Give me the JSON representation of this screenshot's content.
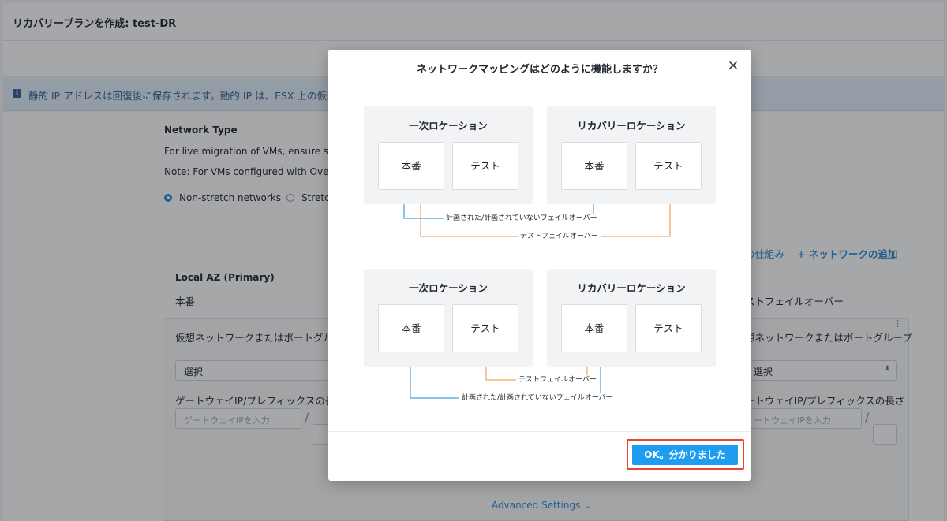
{
  "page": {
    "title": "リカバリープランを作成: test-DR",
    "banner_text": "静的 IP アドレスは回復後に保存されます。動的 IP は、ESX 上の仮想"
  },
  "network_type": {
    "heading": "Network Type",
    "line1": "For live migration of VMs, ensure sour",
    "line2": "Note: For VMs configured with Overla",
    "options": [
      {
        "label": "Non-stretch networks",
        "selected": true
      },
      {
        "label": "Stretc",
        "selected": false
      }
    ]
  },
  "links": {
    "how_it_works": "の仕組み",
    "add_network": "+ ネットワークの追加",
    "advanced_settings": "Advanced Settings ⌄"
  },
  "local_az": {
    "heading": "Local AZ (Primary)",
    "env": "本番",
    "vnet_label": "仮想ネットワークまたはポートグループ",
    "select_value": "選択",
    "gateway_label": "ゲートウェイIP/プレフィックスの長さ",
    "gateway_placeholder": "ゲートウェイIPを入力",
    "slash": "/"
  },
  "remote_az": {
    "env": "ストフェイルオーバー",
    "vnet_label": "想ネットワークまたはポートグループ",
    "select_value": "選択",
    "gateway_label": "ートウェイIP/プレフィックスの長さ",
    "gateway_placeholder": "ートウェイIPを入力",
    "slash": "/"
  },
  "modal": {
    "title": "ネットワークマッピングはどのように機能しますか？",
    "close_icon": "close-icon",
    "ok_label": "OK。分かりました",
    "diagram1": {
      "primary_title": "一次ロケーション",
      "recovery_title": "リカバリーロケーション",
      "prod": "本番",
      "test": "テスト",
      "failover_label": "計画された/計画されていないフェイルオーバー",
      "test_failover_label": "テストフェイルオーバー"
    },
    "diagram2": {
      "primary_title": "一次ロケーション",
      "recovery_title": "リカバリーロケーション",
      "prod": "本番",
      "test": "テスト",
      "failover_label": "計画された/計画されていないフェイルオーバー",
      "test_failover_label": "テストフェイルオーバー"
    },
    "colors": {
      "failover": "#3ca0e0",
      "test_failover": "#f5a25d",
      "ok_button": "#1e9cf0",
      "highlight": "#e8452c"
    }
  }
}
